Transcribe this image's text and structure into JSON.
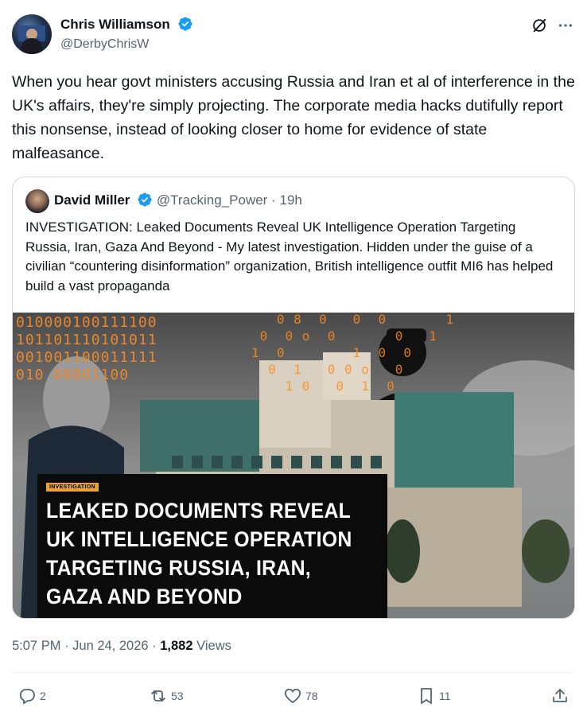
{
  "author": {
    "name": "Chris Williamson",
    "handle": "@DerbyChrisW",
    "verified": true
  },
  "tweet_text": "When you hear govt ministers accusing Russia and Iran et al of interference in the UK's affairs, they're simply projecting. The corporate media hacks dutifully report this nonsense, instead of looking closer to home for evidence of state malfeasance.",
  "quoted": {
    "name": "David Miller",
    "handle": "@Tracking_Power",
    "separator": "·",
    "time": "19h",
    "verified": true,
    "text": "INVESTIGATION: Leaked Documents Reveal UK Intelligence Operation Targeting Russia, Iran, Gaza And Beyond - My latest investigation. Hidden under the guise of a civilian “countering disinformation” organization, British intelligence outfit MI6 has helped build a vast propaganda",
    "image": {
      "tag": "INVESTIGATION",
      "title": "LEAKED DOCUMENTS REVEAL UK INTELLIGENCE OPERATION TARGETING RUSSIA, IRAN, GAZA AND BEYOND"
    }
  },
  "meta": {
    "time": "5:07 PM",
    "sep1": "·",
    "date": "Jun 24, 2026",
    "sep2": "·",
    "views_count": "1,882",
    "views_label": "Views"
  },
  "actions": {
    "replies": "2",
    "reposts": "53",
    "likes": "78",
    "bookmarks": "11"
  },
  "icons": [
    "verified-badge-icon",
    "grok-icon",
    "more-icon",
    "reply-icon",
    "repost-icon",
    "like-icon",
    "bookmark-icon",
    "share-icon"
  ],
  "colors": {
    "verified": "#1d9bf0",
    "muted": "#536471",
    "text": "#0f1419",
    "binary_orange": "#f08a2a",
    "caption_tag": "#e5a33a"
  }
}
